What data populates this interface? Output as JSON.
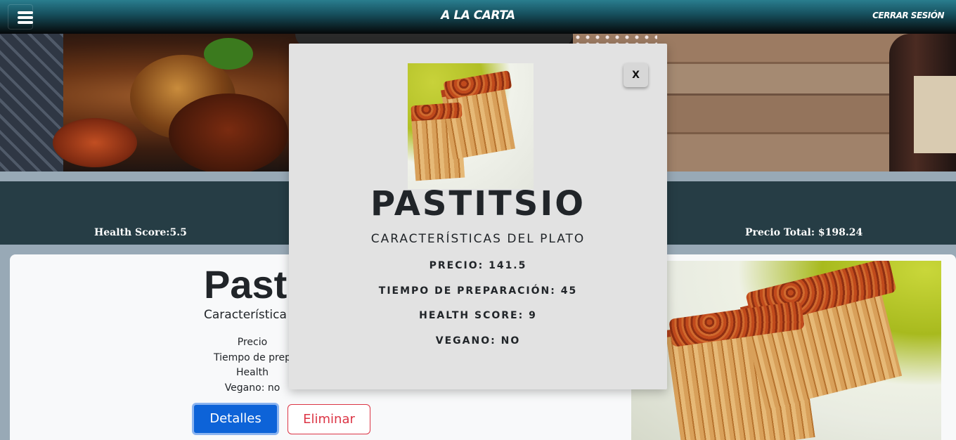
{
  "navbar": {
    "menu_icon": "hamburger-menu-icon",
    "brand": "A LA CARTA",
    "logout_label": "CERRAR SESIÓN"
  },
  "summary": {
    "health_score": "Health Score:5.5",
    "total_price": "Precio Total: $198.24"
  },
  "dish_card": {
    "title": "Pasti",
    "subtitle": "Característica",
    "lines": [
      "Precio",
      "Tiempo de prep",
      "Health",
      "Vegano: no"
    ],
    "details_button": "Detalles",
    "delete_button": "Eliminar"
  },
  "modal": {
    "close_label": "X",
    "title": "PASTITSIO",
    "subtitle": "CARACTERÍSTICAS DEL PLATO",
    "price": "PRECIO: 141.5",
    "prep_time": "TIEMPO DE PREPARACIÓN: 45",
    "health_score": "HEALTH SCORE: 9",
    "vegan": "VEGANO: NO"
  },
  "colors": {
    "navbar_top": "#2a7d8e",
    "navbar_bottom": "#050708",
    "band": "#263d45",
    "page_bg": "#98a9b6",
    "details_button": "#0d63d8",
    "delete_button": "#dc3545",
    "modal_bg": "#e2e2e2"
  }
}
